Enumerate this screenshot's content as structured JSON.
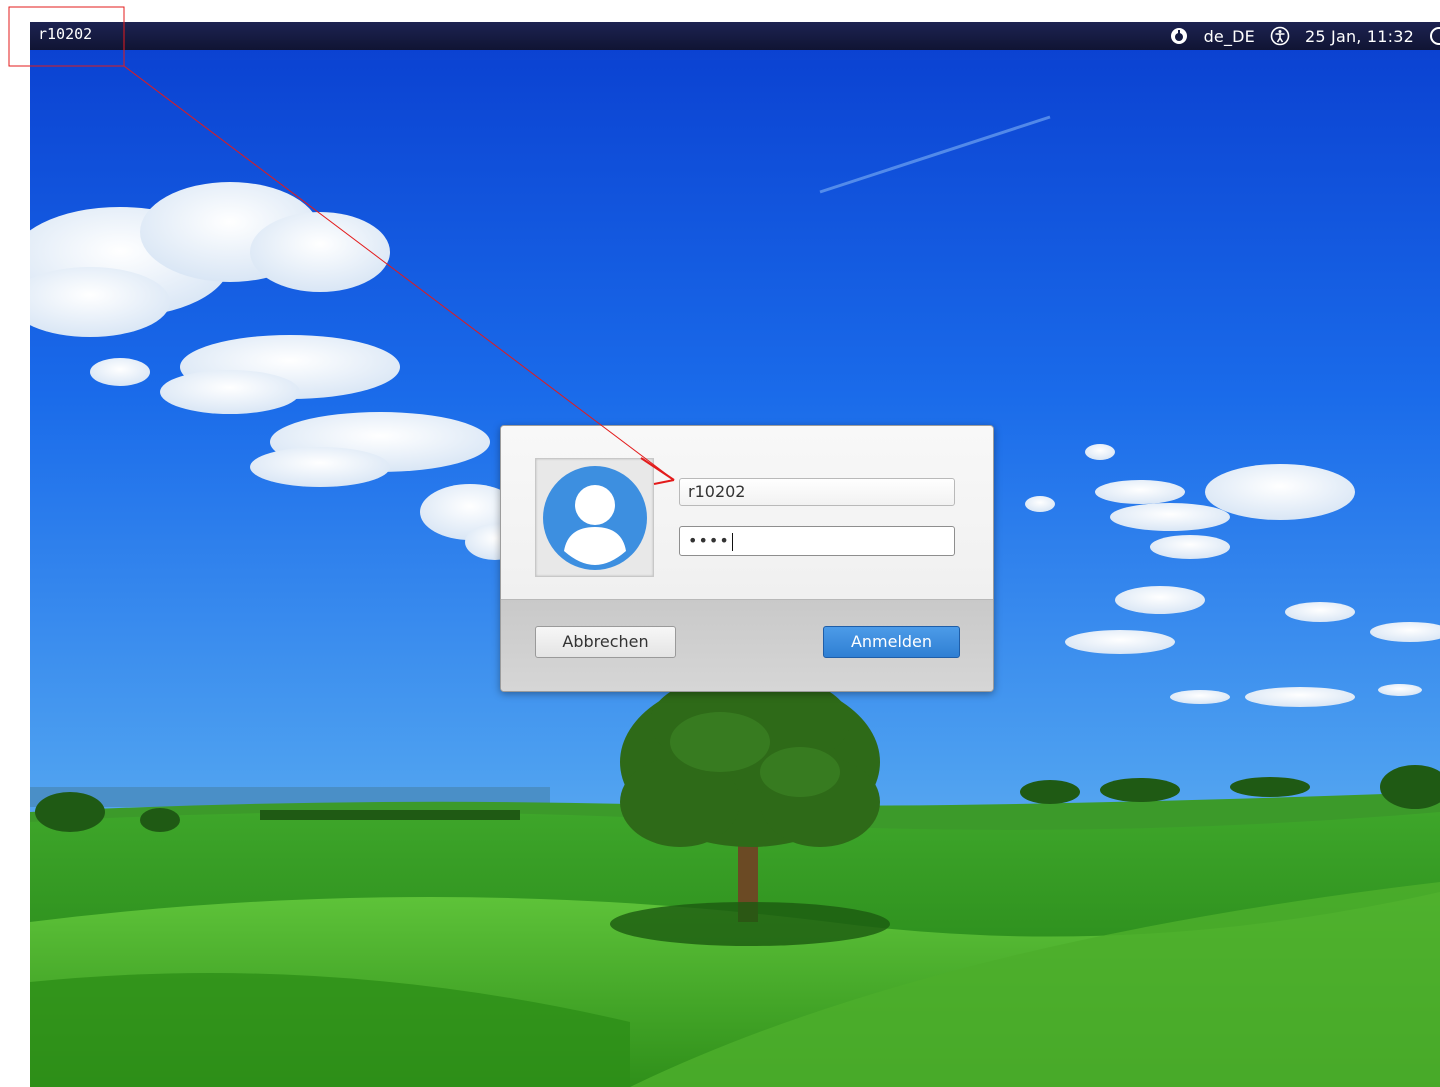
{
  "topbar": {
    "hostname": "r10202",
    "keyboard_layout": "de_DE",
    "datetime": "25 Jan, 11:32",
    "icons": [
      "power-status-icon",
      "accessibility-icon",
      "power-icon"
    ]
  },
  "login_dialog": {
    "username_value": "r10202",
    "password_mask": "••••",
    "cancel_label": "Abbrechen",
    "login_label": "Anmelden",
    "avatar_icon": "user-avatar-icon"
  },
  "annotation": {
    "highlight_color": "#e31b1b"
  },
  "colors": {
    "topbar_bg": "#141a40",
    "login_button": "#3a88dd",
    "avatar": "#3d8fe0"
  }
}
